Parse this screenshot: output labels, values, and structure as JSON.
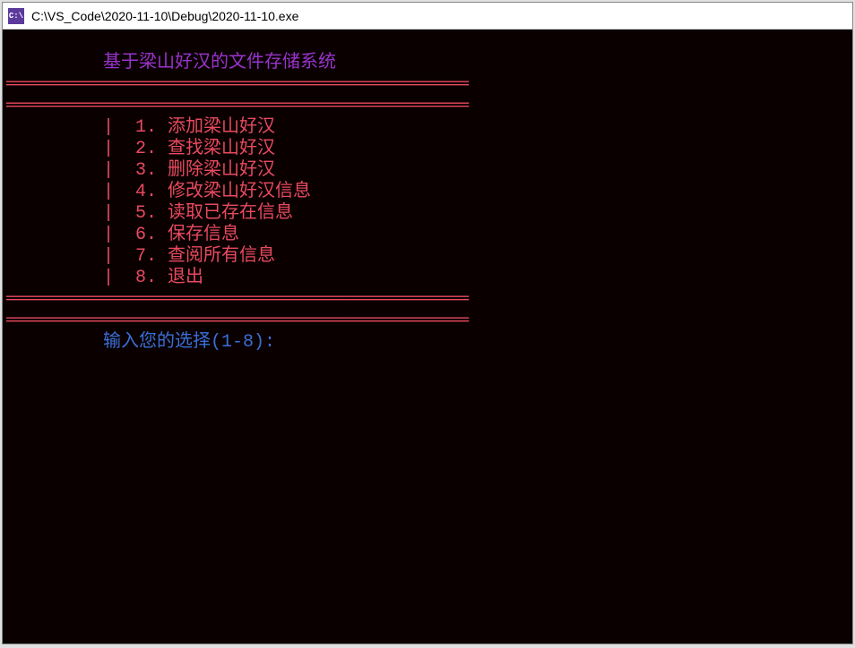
{
  "window": {
    "icon_label": "C:\\",
    "title": "C:\\VS_Code\\2020-11-10\\Debug\\2020-11-10.exe"
  },
  "console": {
    "heading_indent": "         ",
    "heading": "基于梁山好汉的文件存储系统",
    "divider": "═══════════════════════════════════════════",
    "menu_indent": "         ",
    "menu_pipe": "|  ",
    "items": [
      "1. 添加梁山好汉",
      "2. 查找梁山好汉",
      "3. 删除梁山好汉",
      "4. 修改梁山好汉信息",
      "5. 读取已存在信息",
      "6. 保存信息",
      "7. 查阅所有信息",
      "8. 退出"
    ],
    "prompt_indent": "         ",
    "prompt": "输入您的选择(1-8):"
  }
}
